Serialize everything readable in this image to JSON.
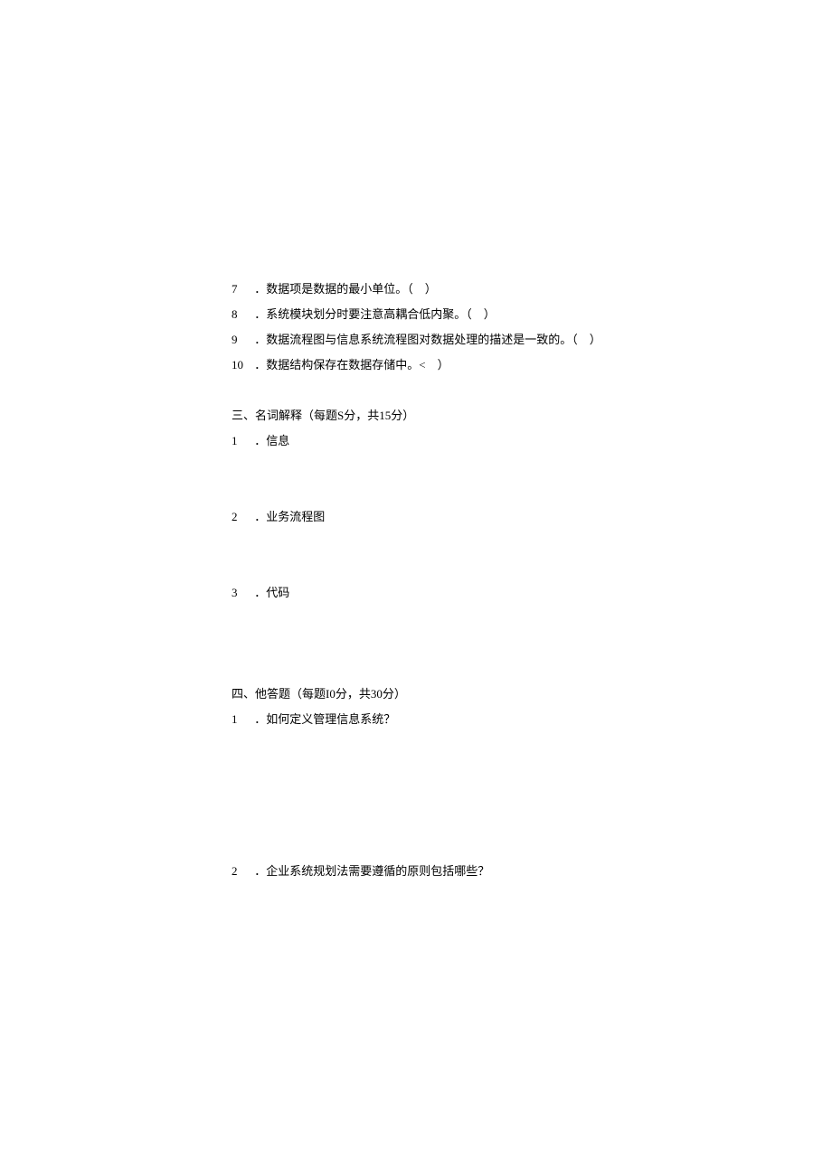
{
  "questions_tf": [
    {
      "num": "7",
      "text": "．数据项是数据的最小单位。（　）"
    },
    {
      "num": "8",
      "text": "．系统模块划分时要注意高耦合低内聚。（　）"
    },
    {
      "num": "9",
      "text": "．数据流程图与信息系统流程图对数据处理的描述是一致的。（　）"
    },
    {
      "num": "10",
      "text": "．数据结构保存在数据存储中。<　）"
    }
  ],
  "section3": {
    "heading": "三、名词解释（每题S分，共15分）",
    "items": [
      {
        "num": "1",
        "text": "．信息"
      },
      {
        "num": "2",
        "text": "．业务流程图"
      },
      {
        "num": "3",
        "text": "．代码"
      }
    ]
  },
  "section4": {
    "heading": "四、他答题（每题I0分，共30分）",
    "items": [
      {
        "num": "1",
        "text": "．如何定义管理信息系统？"
      },
      {
        "num": "2",
        "text": "．企业系统规划法需要遵循的原则包括哪些？"
      }
    ]
  }
}
